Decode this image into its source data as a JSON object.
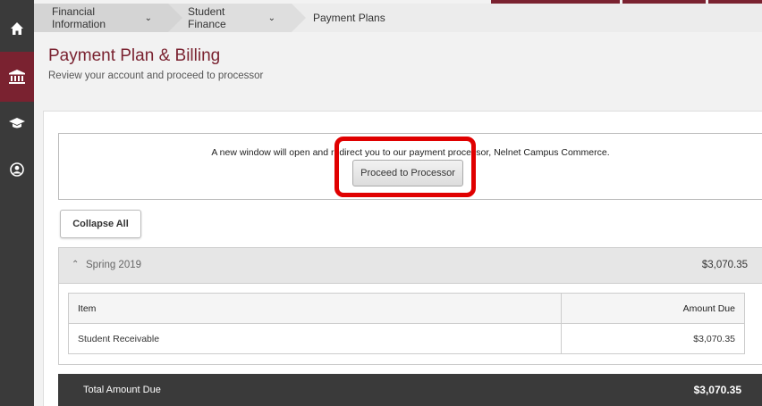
{
  "colors": {
    "brand": "#7a2230",
    "rail": "#3a3a3a",
    "highlight": "#e00000"
  },
  "nav": {
    "items": [
      {
        "icon": "home-icon"
      },
      {
        "icon": "bank-icon",
        "active": true
      },
      {
        "icon": "graduation-cap-icon"
      },
      {
        "icon": "user-circle-icon"
      }
    ]
  },
  "breadcrumb": {
    "items": [
      {
        "label": "Financial Information"
      },
      {
        "label": "Student Finance"
      },
      {
        "label": "Payment Plans"
      }
    ]
  },
  "header": {
    "title": "Payment Plan & Billing",
    "subtitle": "Review your account and proceed to processor"
  },
  "notice": {
    "text": "A new window will open and redirect you to our payment processor, Nelnet Campus Commerce.",
    "button_label": "Proceed to Processor"
  },
  "actions": {
    "collapse_label": "Collapse All"
  },
  "term": {
    "name": "Spring 2019",
    "total": "$3,070.35",
    "table": {
      "columns": [
        "Item",
        "Amount Due"
      ],
      "rows": [
        {
          "item": "Student Receivable",
          "amount": "$3,070.35"
        }
      ]
    }
  },
  "summary": {
    "label": "Total Amount Due",
    "value": "$3,070.35"
  }
}
